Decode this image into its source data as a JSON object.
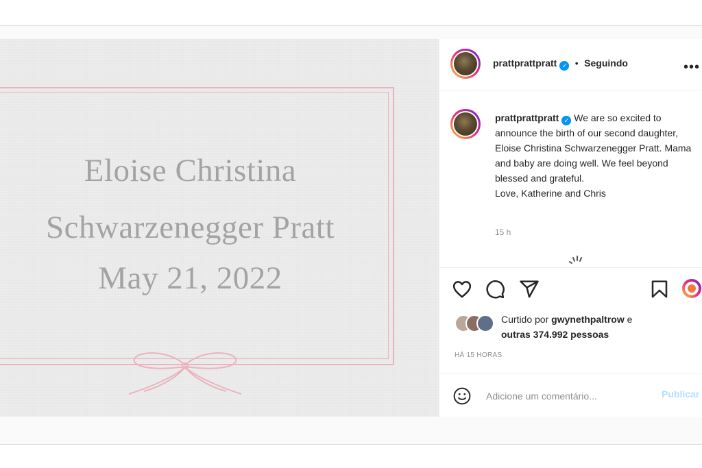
{
  "post": {
    "image": {
      "name_line1": "Eloise Christina",
      "name_line2": "Schwarzenegger Pratt",
      "date_line": "May 21, 2022"
    },
    "header": {
      "username": "prattprattpratt",
      "separator": "•",
      "follow_status": "Seguindo",
      "more_label": "•••"
    },
    "caption": {
      "username": "prattprattpratt",
      "text": "We are so excited to announce the birth of our second daughter, Eloise Christina Schwarzenegger Pratt. Mama and baby are doing well. We feel beyond blessed and grateful.",
      "signoff": "Love, Katherine and Chris",
      "time": "15 h"
    },
    "likes": {
      "prefix": "Curtido por",
      "liked_by": "gwynethpaltrow",
      "joiner": "e",
      "others": "outras 374.992 pessoas"
    },
    "posted_time": "HÁ 15 HORAS",
    "comment": {
      "placeholder": "Adicione um comentário...",
      "publish_label": "Publicar"
    }
  },
  "colors": {
    "accent_blue": "#0095f6",
    "publish_disabled": "#b2dffc",
    "card_pink": "#eab3bd",
    "card_text": "#a3a3a3"
  },
  "icons": [
    "heart-icon",
    "comment-icon",
    "share-icon",
    "bookmark-icon",
    "emoji-icon",
    "verified-icon",
    "more-icon",
    "loading-spinner-icon"
  ]
}
